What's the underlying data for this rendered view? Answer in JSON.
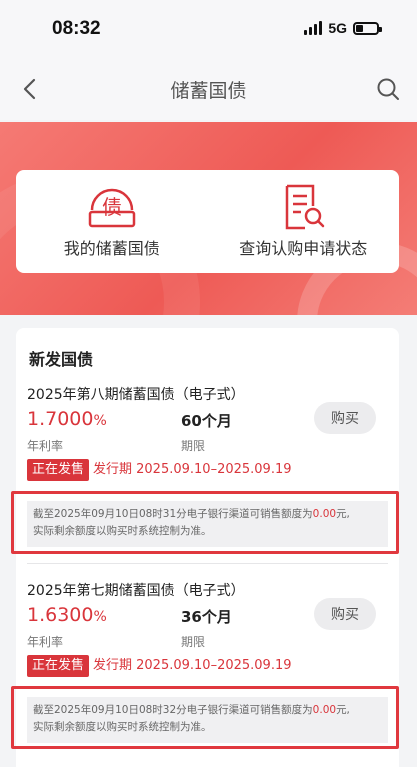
{
  "status": {
    "time": "08:32",
    "network": "5G"
  },
  "nav": {
    "title": "储蓄国债"
  },
  "quick_actions": [
    {
      "label": "我的储蓄国债",
      "icon": "bond-coin-icon",
      "icon_char": "债"
    },
    {
      "label": "查询认购申请状态",
      "icon": "document-search-icon"
    }
  ],
  "section": {
    "title": "新发国债",
    "bonds": [
      {
        "name": "2025年第八期储蓄国债（电子式）",
        "rate": "1.7000",
        "rate_unit": "%",
        "rate_label": "年利率",
        "term": "60个月",
        "term_label": "期限",
        "buy_label": "购买",
        "badge": "正在发售",
        "period": "发行期 2025.09.10–2025.09.19",
        "notice_prefix": "截至2025年09月10日08时31分电子银行渠道可销售额度为",
        "notice_amount": "0.00",
        "notice_suffix": "元,",
        "notice_line2": "实际剩余额度以购买时系统控制为准。"
      },
      {
        "name": "2025年第七期储蓄国债（电子式）",
        "rate": "1.6300",
        "rate_unit": "%",
        "rate_label": "年利率",
        "term": "36个月",
        "term_label": "期限",
        "buy_label": "购买",
        "badge": "正在发售",
        "period": "发行期 2025.09.10–2025.09.19",
        "notice_prefix": "截至2025年09月10日08时32分电子银行渠道可销售额度为",
        "notice_amount": "0.00",
        "notice_suffix": "元,",
        "notice_line2": "实际剩余额度以购买时系统控制为准。"
      }
    ]
  },
  "colors": {
    "brand_red": "#d9353b",
    "highlight_red": "#e0383e",
    "banner_red": "#ee5a55"
  }
}
